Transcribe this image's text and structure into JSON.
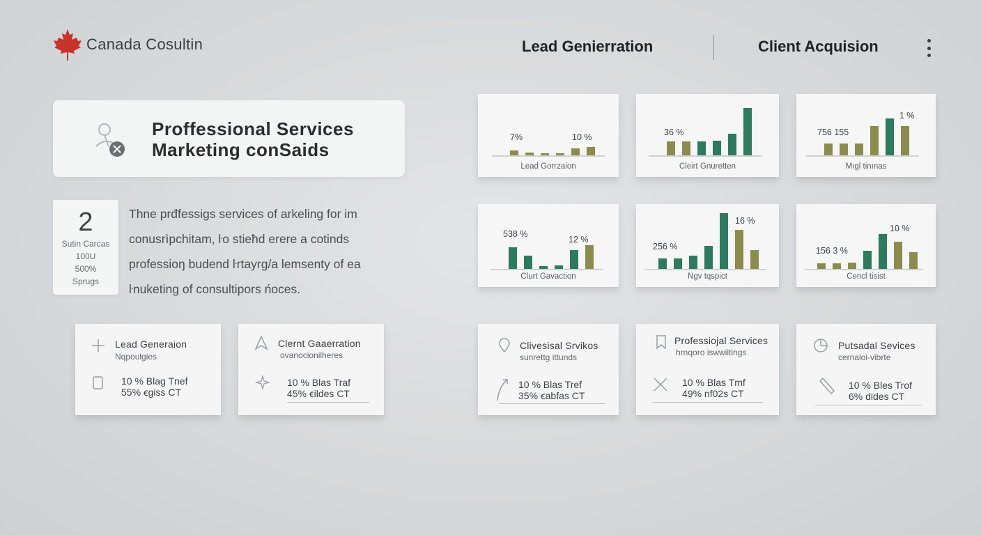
{
  "header": {
    "brand": "Canada Cosultin",
    "nav": [
      "Lead Genierration",
      "Client Acquision"
    ]
  },
  "hero": {
    "title_line1": "Proffessional Services",
    "title_line2": "Marketing conSaids"
  },
  "stat": {
    "number": "2",
    "lines": [
      "Sutin Carcas",
      "100U",
      "500%",
      "Sprugs"
    ]
  },
  "description": [
    "Thne prđfessigs services of arkeling for im",
    "conusrìpchitam, ŀo stieħd erere a cotinds",
    "professioŋ budend ŀrtayrg/a lemsenty of ea",
    "ŀnuketing of consultipors ńoces."
  ],
  "feature_cards": [
    {
      "title": "Lead Generaion",
      "sub": "Nqpoulgies",
      "stat1": "10 %  Blag  Tnef",
      "stat2": "55%  ꞓgiss  CT"
    },
    {
      "title": "Clernt Gaaerration",
      "sub": "ovanocionilheres",
      "stat1": "10 %  Blas  Traf",
      "stat2": "45%  ꞓildes  CT"
    },
    {
      "title": "Clivesisal Srvikos",
      "sub": "sunrettg ittunds",
      "stat1": "10 %  Blas  Tref",
      "stat2": "35%  ꞓabfas  CT"
    },
    {
      "title": "Professiojal Services",
      "sub": "hrnqoro iswwiitings",
      "stat1": "10 %  Blas  Tmf",
      "stat2": "49%  nf02s  CT"
    },
    {
      "title": "Putsadal Sevices",
      "sub": "cernaloi-vibrte",
      "stat1": "10 %  Bles  Trof",
      "stat2": "6%  dides  CT"
    }
  ],
  "chart_data": [
    {
      "type": "bar",
      "title": "Lead Gorrzaion",
      "labels": [
        "7%",
        "10 %"
      ],
      "values": [
        7,
        4,
        3,
        3,
        10,
        12
      ],
      "colors": [
        "#8c8b4e",
        "#8c8b4e",
        "#8c8b4e",
        "#8c8b4e",
        "#8c8b4e",
        "#8c8b4e"
      ]
    },
    {
      "title": "Cleirt Gnuretten",
      "type": "bar",
      "labels": [
        "36 %"
      ],
      "values": [
        20,
        20,
        20,
        21,
        31,
        68
      ],
      "colors": [
        "#8c8b4e",
        "#8c8b4e",
        "#2d7a5e",
        "#2d7a5e",
        "#2d7a5e",
        "#2d7a5e"
      ]
    },
    {
      "title": "Mıgl tinınas",
      "type": "bar",
      "labels": [
        "756 155",
        "1 %"
      ],
      "values": [
        17,
        17,
        17,
        42,
        53,
        42
      ],
      "colors": [
        "#8c8b4e",
        "#8c8b4e",
        "#8c8b4e",
        "#8c8b4e",
        "#2d7a5e",
        "#8c8b4e"
      ]
    },
    {
      "title": "Clurt Gavaction",
      "type": "bar",
      "labels": [
        "538 %",
        "12 %"
      ],
      "values": [
        31,
        19,
        4,
        5,
        27,
        34
      ],
      "colors": [
        "#2d7a5e",
        "#2d7a5e",
        "#2d7a5e",
        "#2d7a5e",
        "#2d7a5e",
        "#8c8b4e"
      ]
    },
    {
      "title": "Ngv tqspict",
      "type": "bar",
      "labels": [
        "256 %",
        "16 %"
      ],
      "values": [
        15,
        15,
        19,
        33,
        80,
        56,
        27
      ],
      "colors": [
        "#2d7a5e",
        "#2d7a5e",
        "#2d7a5e",
        "#2d7a5e",
        "#2d7a5e",
        "#8c8b4e",
        "#8c8b4e"
      ]
    },
    {
      "title": "Cencl tisist",
      "type": "bar",
      "labels": [
        "156 3 %",
        "10 %"
      ],
      "values": [
        8,
        8,
        9,
        26,
        50,
        39,
        24
      ],
      "colors": [
        "#8c8b4e",
        "#8c8b4e",
        "#8c8b4e",
        "#2d7a5e",
        "#2d7a5e",
        "#8c8b4e",
        "#8c8b4e"
      ]
    }
  ]
}
